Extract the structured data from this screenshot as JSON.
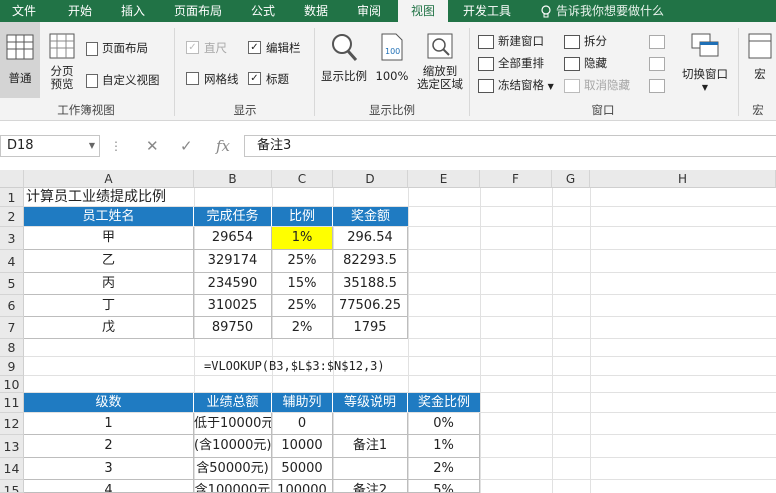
{
  "ribbon_tabs": [
    "文件",
    "开始",
    "插入",
    "页面布局",
    "公式",
    "数据",
    "审阅",
    "视图",
    "开发工具"
  ],
  "active_tab": "视图",
  "tell_me": "告诉我你想要做什么",
  "groups": {
    "workbook_views": {
      "label": "工作簿视图",
      "normal": "普通",
      "page_break_preview": "分页\n预览",
      "page_layout": "页面布局",
      "custom_views": "自定义视图"
    },
    "show": {
      "label": "显示",
      "ruler": "直尺",
      "formula_bar": "编辑栏",
      "gridlines": "网格线",
      "headings": "标题"
    },
    "zoom": {
      "label": "显示比例",
      "zoom": "显示比例",
      "zoom100": "100%",
      "zoom_selection": "缩放到\n选定区域"
    },
    "window": {
      "label": "窗口",
      "new_window": "新建窗口",
      "arrange_all": "全部重排",
      "freeze_panes": "冻结窗格",
      "split": "拆分",
      "hide": "隐藏",
      "unhide": "取消隐藏",
      "switch_windows": "切换窗口"
    },
    "macros": {
      "label": "宏",
      "macros": "宏"
    }
  },
  "name_box": "D18",
  "formula_bar_value": "备注3",
  "columns": [
    "A",
    "B",
    "C",
    "D",
    "E",
    "F",
    "G",
    "H"
  ],
  "rows": [
    "1",
    "2",
    "3",
    "4",
    "5",
    "6",
    "7",
    "8",
    "9",
    "10",
    "11",
    "12",
    "13",
    "14"
  ],
  "sheet": {
    "title": "计算员工业绩提成比例",
    "table1_headers": [
      "员工姓名",
      "完成任务",
      "比例",
      "奖金额"
    ],
    "table1_rows": [
      [
        "甲",
        "29654",
        "1%",
        "296.54"
      ],
      [
        "乙",
        "329174",
        "25%",
        "82293.5"
      ],
      [
        "丙",
        "234590",
        "15%",
        "35188.5"
      ],
      [
        "丁",
        "310025",
        "25%",
        "77506.25"
      ],
      [
        "戊",
        "89750",
        "2%",
        "1795"
      ]
    ],
    "formula_text": "=VLOOKUP(B3,$L$3:$N$12,3)",
    "table2_headers": [
      "级数",
      "业绩总额",
      "辅助列",
      "等级说明",
      "奖金比例"
    ],
    "table2_rows": [
      [
        "1",
        "低于10000元",
        "0",
        "",
        "0%"
      ],
      [
        "2",
        "(含10000元)",
        "10000",
        "备注1",
        "1%"
      ],
      [
        "3",
        "含50000元)",
        "50000",
        "",
        "2%"
      ],
      [
        "4",
        "含100000元",
        "100000",
        "备注2",
        "5%"
      ]
    ]
  },
  "colors": {
    "ribbon_green": "#217346",
    "table_header_blue": "#1f7bc2",
    "highlight_yellow": "#ffff00"
  }
}
